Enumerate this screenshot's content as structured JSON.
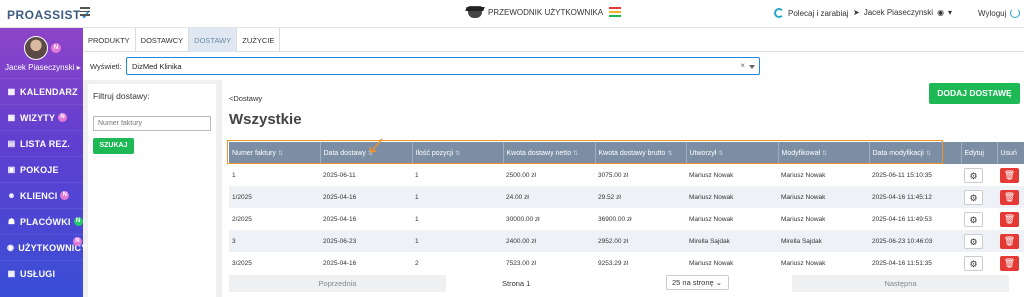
{
  "app": {
    "logo": "PROASSIST"
  },
  "topbar": {
    "guide_label": "PRZEWODNIK UŻYTKOWNIKA",
    "refer_label": "Polecaj i zarabiaj",
    "user_name": "Jacek Piaseczynski",
    "logout_label": "Wyloguj"
  },
  "sidebar": {
    "profile_name": "Jacek Piaseczynski",
    "profile_badge": "N",
    "items": [
      {
        "label": "KALENDARZ",
        "icon": "calendar-icon",
        "badge": ""
      },
      {
        "label": "WIZYTY",
        "icon": "calendar-check-icon",
        "badge": "N"
      },
      {
        "label": "LISTA REZ.",
        "icon": "list-icon",
        "badge": ""
      },
      {
        "label": "POKOJE",
        "icon": "door-icon",
        "badge": ""
      },
      {
        "label": "KLIENCI",
        "icon": "users-icon",
        "badge": "N"
      },
      {
        "label": "PLACÓWKI",
        "icon": "building-icon",
        "badge": "N"
      },
      {
        "label": "UŻYTKOWNICY",
        "icon": "user-circle-icon",
        "badge": "N"
      },
      {
        "label": "USŁUGI",
        "icon": "grid-icon",
        "badge": ""
      }
    ]
  },
  "tabs": [
    "PRODUKTY",
    "DOSTAWCY",
    "DOSTAWY",
    "ZUŻYCIE"
  ],
  "active_tab": "DOSTAWY",
  "display": {
    "label": "Wyświetl:",
    "value": "DizMed Klinika"
  },
  "filter": {
    "title": "Filtruj dostawy:",
    "placeholder": "Numer faktury",
    "button": "SZUKAJ"
  },
  "main": {
    "breadcrumb": "<Dostawy",
    "title": "Wszystkie",
    "add_button": "DODAJ DOSTAWĘ"
  },
  "table": {
    "headers": [
      "Numer faktury",
      "Data dostawy",
      "Ilość pozycji",
      "Kwota dostawy netto",
      "Kwota dostawy brutto",
      "Utworzył",
      "Modyfikował",
      "Data modyfikacji",
      "Edytuj",
      "Usuń"
    ],
    "rows": [
      [
        "1",
        "2025-06-11",
        "1",
        "2500.00 zł",
        "3075.00 zł",
        "Mariusz Nowak",
        "Mariusz Nowak",
        "2025-06-11 15:10:35"
      ],
      [
        "1/2025",
        "2025-04-16",
        "1",
        "24.00 zł",
        "29.52 zł",
        "Mariusz Nowak",
        "Mariusz Nowak",
        "2025-04-16 11:45:12"
      ],
      [
        "2/2025",
        "2025-04-16",
        "1",
        "30000.00 zł",
        "36900.00 zł",
        "Mariusz Nowak",
        "Mariusz Nowak",
        "2025-04-16 11:49:53"
      ],
      [
        "3",
        "2025-06-23",
        "1",
        "2400.00 zł",
        "2952.00 zł",
        "Mirella Sajdak",
        "Mirella Sajdak",
        "2025-06-23 10:46:03"
      ],
      [
        "3/2025",
        "2025-04-16",
        "2",
        "7523.00 zł",
        "9253.29 zł",
        "Mariusz Nowak",
        "Mariusz Nowak",
        "2025-04-16 11:51:35"
      ]
    ]
  },
  "pager": {
    "prev": "Poprzednia",
    "page_info": "Strona 1",
    "page_size": "25 na stronę",
    "next": "Następna"
  },
  "colors": {
    "accent_green": "#1db954",
    "delete_red": "#e53935",
    "header_blue": "#7b8ea3",
    "highlight_orange": "#f0932b"
  }
}
